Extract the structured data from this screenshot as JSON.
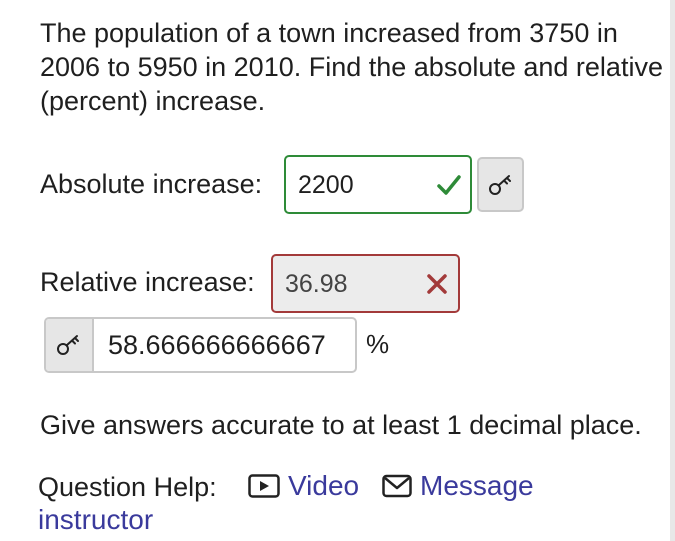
{
  "question": {
    "prompt": "The population of a town increased from 3750 in 2006 to 5950 in 2010. Find the absolute and relative (percent) increase."
  },
  "absolute": {
    "label": "Absolute increase:",
    "value": "2200",
    "status": "correct"
  },
  "relative": {
    "label": "Relative increase:",
    "value": "36.98",
    "status": "incorrect",
    "correct_answer": "58.666666666667",
    "unit": "%"
  },
  "instructions": "Give answers accurate to at least 1 decimal place.",
  "help": {
    "label": "Question Help:",
    "video_label": "Video",
    "message_label_1": "Message",
    "message_label_2": "instructor"
  },
  "colors": {
    "correct": "#2e8b38",
    "incorrect": "#a33a3a",
    "link": "#3a3a9c"
  },
  "icons": [
    "check-icon",
    "x-icon",
    "key-icon",
    "video-icon",
    "mail-icon"
  ]
}
